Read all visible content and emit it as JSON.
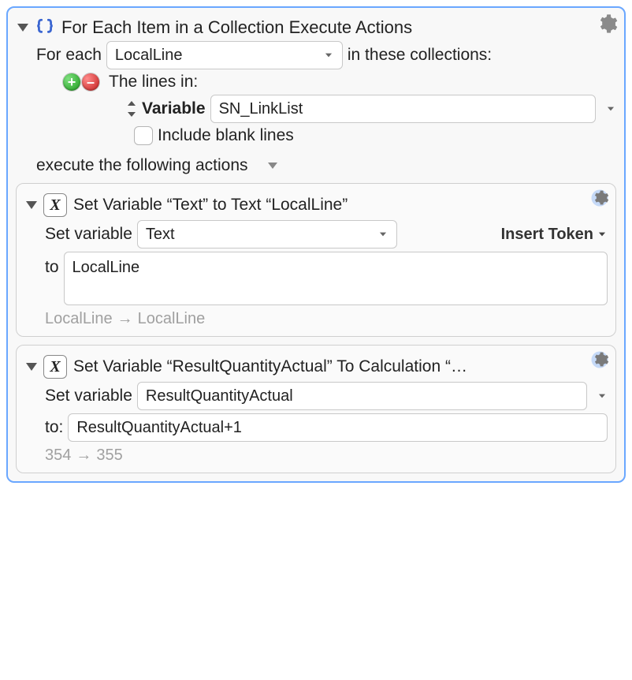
{
  "forEach": {
    "title": "For Each Item in a Collection Execute Actions",
    "forEachLabel": "For each",
    "loopVar": "LocalLine",
    "inTheseCollections": "in these collections:",
    "theLinesIn": "The lines in:",
    "variableLabel": "Variable",
    "variableValue": "SN_LinkList",
    "includeBlankLabel": "Include blank lines",
    "executeLabel": "execute the following actions"
  },
  "action1": {
    "title": "Set Variable “Text” to Text “LocalLine”",
    "setVarLabel": "Set variable",
    "varName": "Text",
    "insertToken": "Insert Token",
    "toLabel": "to",
    "toValue": "LocalLine",
    "hintLeft": "LocalLine",
    "hintRight": "LocalLine"
  },
  "action2": {
    "title": "Set Variable “ResultQuantityActual” To Calculation “…",
    "setVarLabel": "Set variable",
    "varName": "ResultQuantityActual",
    "toLabel": "to:",
    "toValue": "ResultQuantityActual+1",
    "hintLeft": "354",
    "hintRight": "355"
  },
  "glyphs": {
    "arrow": "→",
    "plus": "+",
    "minus": "–"
  }
}
